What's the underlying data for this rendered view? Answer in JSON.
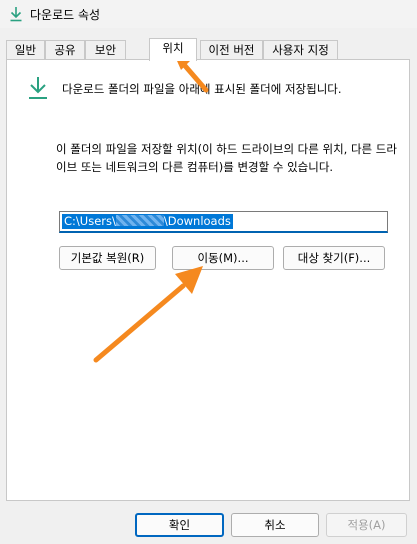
{
  "window": {
    "title": "다운로드 속성"
  },
  "tabs": [
    {
      "label": "일반"
    },
    {
      "label": "공유"
    },
    {
      "label": "보안"
    },
    {
      "label": "위치"
    },
    {
      "label": "이전 버전"
    },
    {
      "label": "사용자 지정"
    }
  ],
  "location": {
    "description": "다운로드 폴더의 파일을 아래에 표시된 폴더에 저장됩니다.",
    "instructions": "이 폴더의 파일을 저장할 위치(이 하드 드라이브의 다른 위치, 다른 드라이브 또는 네트워크의 다른 컴퓨터)를 변경할 수 있습니다.",
    "path_start": "C:\\Users\\",
    "path_end": "\\Downloads",
    "restore_default": "기본값 복원(R)",
    "move": "이동(M)...",
    "find_target": "대상 찾기(F)..."
  },
  "footer": {
    "ok": "확인",
    "cancel": "취소",
    "apply": "적용(A)"
  },
  "colors": {
    "accent": "#0078d7",
    "annotation_arrow": "#f5891f",
    "download_icon": "#2aa181"
  }
}
